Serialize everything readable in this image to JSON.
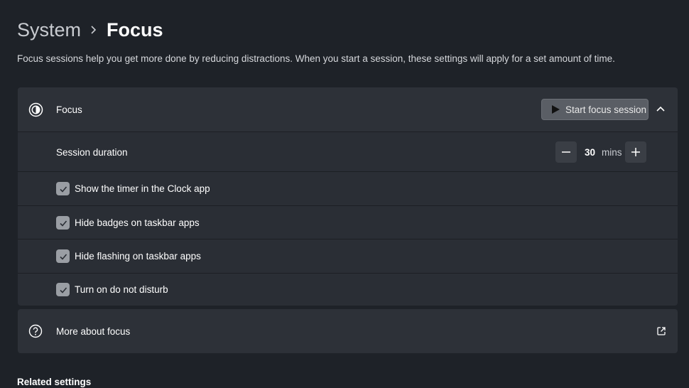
{
  "breadcrumb": {
    "parent": "System",
    "current": "Focus"
  },
  "description": "Focus sessions help you get more done by reducing distractions. When you start a session, these settings will apply for a set amount of time.",
  "focus": {
    "title": "Focus",
    "start_button_label": "Start focus session",
    "icon": "focus-icon",
    "expanded": true
  },
  "session": {
    "label": "Session duration",
    "value": "30",
    "unit": "mins"
  },
  "options": [
    {
      "label": "Show the timer in the Clock app",
      "checked": true
    },
    {
      "label": "Hide badges on taskbar apps",
      "checked": true
    },
    {
      "label": "Hide flashing on taskbar apps",
      "checked": true
    },
    {
      "label": "Turn on do not disturb",
      "checked": true
    }
  ],
  "more": {
    "label": "More about focus",
    "icon": "help-icon"
  },
  "related": {
    "title": "Related settings"
  }
}
